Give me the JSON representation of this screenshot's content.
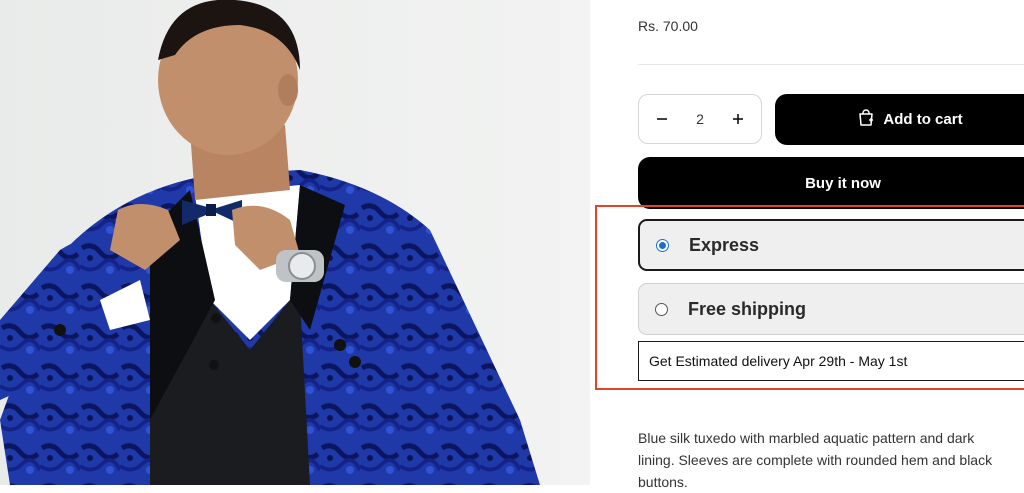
{
  "product": {
    "image_alt": "Man in blue silk tuxedo adjusting bow tie",
    "price": "Rs. 70.00",
    "quantity": "2",
    "add_to_cart_label": "Add to cart",
    "buy_now_label": "Buy it now",
    "description": "Blue silk tuxedo with marbled aquatic pattern and dark lining. Sleeves are complete with rounded hem and black buttons."
  },
  "shipping": {
    "options": [
      {
        "label": "Express",
        "selected": true
      },
      {
        "label": "Free shipping",
        "selected": false
      }
    ],
    "estimate": "Get Estimated delivery Apr 29th - May 1st"
  },
  "icons": {
    "minus": "minus-icon",
    "plus": "plus-icon",
    "cart": "cart-icon",
    "radio_selected": "radio-selected-icon",
    "radio_unselected": "radio-unselected-icon"
  },
  "colors": {
    "primary_button": "#000000",
    "highlight_border": "#e0452c",
    "radio_accent": "#1a6fd1",
    "option_bg": "#efefef"
  }
}
